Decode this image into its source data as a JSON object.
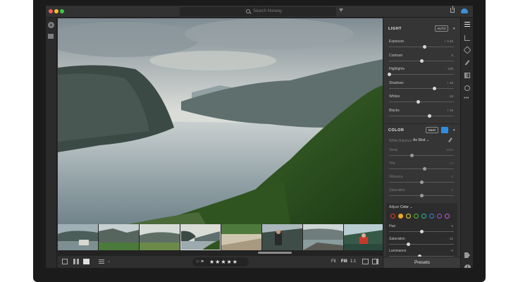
{
  "titlebar": {
    "search_placeholder": "Search Norway",
    "icons": [
      "search-icon",
      "filter-icon",
      "share-icon",
      "cloud-icon"
    ]
  },
  "leftbar": {
    "icons": [
      "add-photos-icon",
      "library-icon"
    ]
  },
  "photo": {
    "subject": "norwegian-fjord-landscape"
  },
  "filmstrip": {
    "thumbnail_count": 8,
    "selected_index": 3,
    "scroll_position": 0.64
  },
  "bottombar": {
    "rating_stars": "★★★★★",
    "flags": "⚐⚑",
    "zoom_fit": "Fit",
    "zoom_fill": "Fill",
    "zoom_one": "1:1"
  },
  "panel": {
    "light": {
      "title": "LIGHT",
      "auto_label": "AUTO",
      "sliders": [
        {
          "label": "Exposure",
          "value": "+ 0.40",
          "pos": 0.55
        },
        {
          "label": "Contrast",
          "value": "0",
          "pos": 0.5
        },
        {
          "label": "Highlights",
          "value": "- 100",
          "pos": 0.0
        },
        {
          "label": "Shadows",
          "value": "+ 40",
          "pos": 0.7
        },
        {
          "label": "Whites",
          "value": "- 10",
          "pos": 0.45
        },
        {
          "label": "Blacks",
          "value": "+ 25",
          "pos": 0.62
        }
      ]
    },
    "color": {
      "title": "COLOR",
      "bw_label": "B&W",
      "white_balance_label": "White Balance",
      "white_balance_value": "As Shot ⌄",
      "sliders": [
        {
          "label": "Temp",
          "value": "5000",
          "pos": 0.35
        },
        {
          "label": "Tint",
          "value": "+ 6",
          "pos": 0.55
        },
        {
          "label": "Vibrance",
          "value": "0",
          "pos": 0.5
        },
        {
          "label": "Saturation",
          "value": "0",
          "pos": 0.5
        }
      ]
    },
    "mixer": {
      "adjust_label": "Adjust",
      "mode_value": "Color ⌄",
      "swatches": [
        "#e03a2e",
        "#f2a623",
        "#e8d62a",
        "#4bbf3a",
        "#2bbfb0",
        "#3a7fe0",
        "#9b4fe0",
        "#d84fd0"
      ],
      "active_swatch": 1,
      "sliders": [
        {
          "label": "Hue",
          "value": "0",
          "pos": 0.5
        },
        {
          "label": "Saturation",
          "value": "- 32",
          "pos": 0.3
        },
        {
          "label": "Luminance",
          "value": "- 5",
          "pos": 0.47
        }
      ]
    },
    "presets_label": "Presets"
  },
  "rightbar": {
    "icons": [
      "edit-sliders-icon",
      "crop-icon",
      "healing-icon",
      "brush-icon",
      "linear-gradient-icon",
      "radial-gradient-icon",
      "more-icon",
      "keyword-tag-icon",
      "info-icon"
    ]
  },
  "colors": {
    "accent": "#2d8ee0",
    "panel_bg": "#353535",
    "screen_bg": "#2a2a2a"
  }
}
